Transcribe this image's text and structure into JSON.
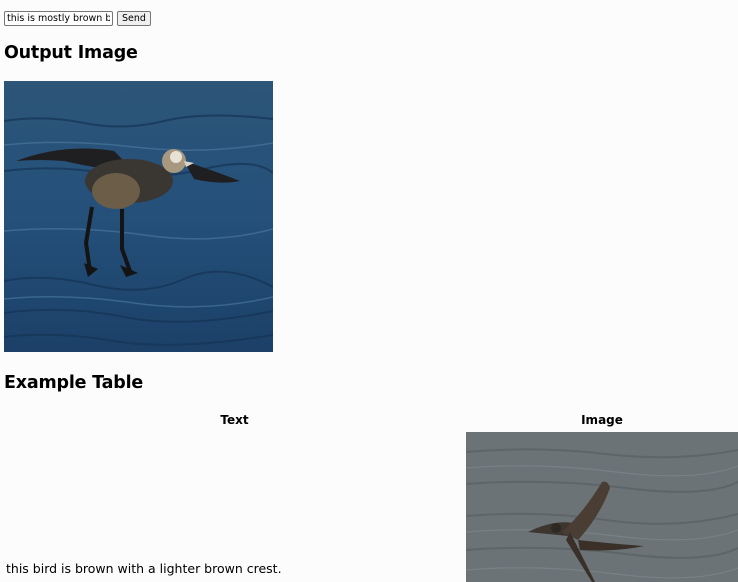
{
  "form": {
    "prompt_value": "this is mostly brown bird",
    "send_label": "Send"
  },
  "output": {
    "heading": "Output Image",
    "image_subject": "bird-photo"
  },
  "example_table": {
    "heading": "Example Table",
    "columns": [
      "Text",
      "Image"
    ],
    "rows": [
      {
        "text": "this bird is brown with a lighter brown crest.",
        "image_subject": "bird-photo"
      }
    ]
  }
}
